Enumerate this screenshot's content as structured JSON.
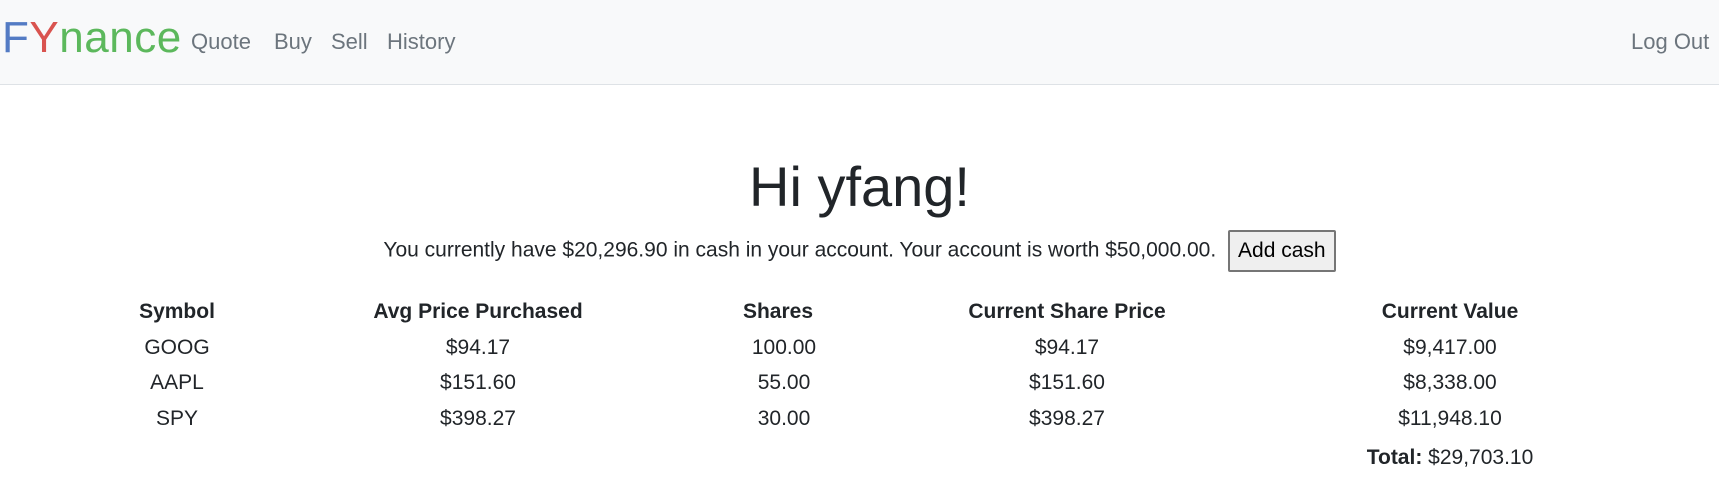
{
  "navbar": {
    "brand_letters": [
      {
        "char": "F",
        "color": "#537bc4"
      },
      {
        "char": "Y",
        "color": "#d9534f"
      },
      {
        "char": "n",
        "color": "#5cb85c"
      },
      {
        "char": "a",
        "color": "#5cb85c"
      },
      {
        "char": "n",
        "color": "#5cb85c"
      },
      {
        "char": "c",
        "color": "#5cb85c"
      },
      {
        "char": "e",
        "color": "#5cb85c"
      }
    ],
    "links": [
      "Quote",
      "Buy",
      "Sell",
      "History"
    ],
    "logout": "Log Out"
  },
  "main": {
    "greeting": "Hi yfang!",
    "cash_message": "You currently have $20,296.90 in cash in your account. Your account is worth $50,000.00.",
    "add_cash_label": "Add cash",
    "table": {
      "headers": [
        "Symbol",
        "Avg Price Purchased",
        "Shares",
        "Current Share Price",
        "Current Value"
      ],
      "rows": [
        [
          "GOOG",
          "$94.17",
          "100.00",
          "$94.17",
          "$9,417.00"
        ],
        [
          "AAPL",
          "$151.60",
          "55.00",
          "$151.60",
          "$8,338.00"
        ],
        [
          "SPY",
          "$398.27",
          "30.00",
          "$398.27",
          "$11,948.10"
        ]
      ]
    },
    "total_label": "Total:",
    "total_value": "$29,703.10"
  },
  "colors": {
    "navbar_bg": "#f8f9fa",
    "nav_link": "#6c757d",
    "text": "#212529"
  }
}
